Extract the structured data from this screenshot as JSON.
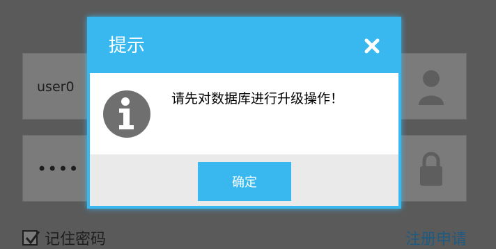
{
  "login": {
    "username_value": "user0",
    "password_value": "••••",
    "remember_label": "记住密码",
    "register_link": "注册申请"
  },
  "dialog": {
    "title": "提示",
    "message": "请先对数据库进行升级操作！",
    "ok_label": "确定",
    "icons": {
      "info": "info-icon",
      "close": "close-icon",
      "user": "user-icon",
      "lock": "lock-icon"
    }
  },
  "colors": {
    "accent": "#38b8ef",
    "overlay_bg": "#5a5a5a",
    "footer_bg": "#eaeaea",
    "icon_gray": "#6f6f6f"
  }
}
